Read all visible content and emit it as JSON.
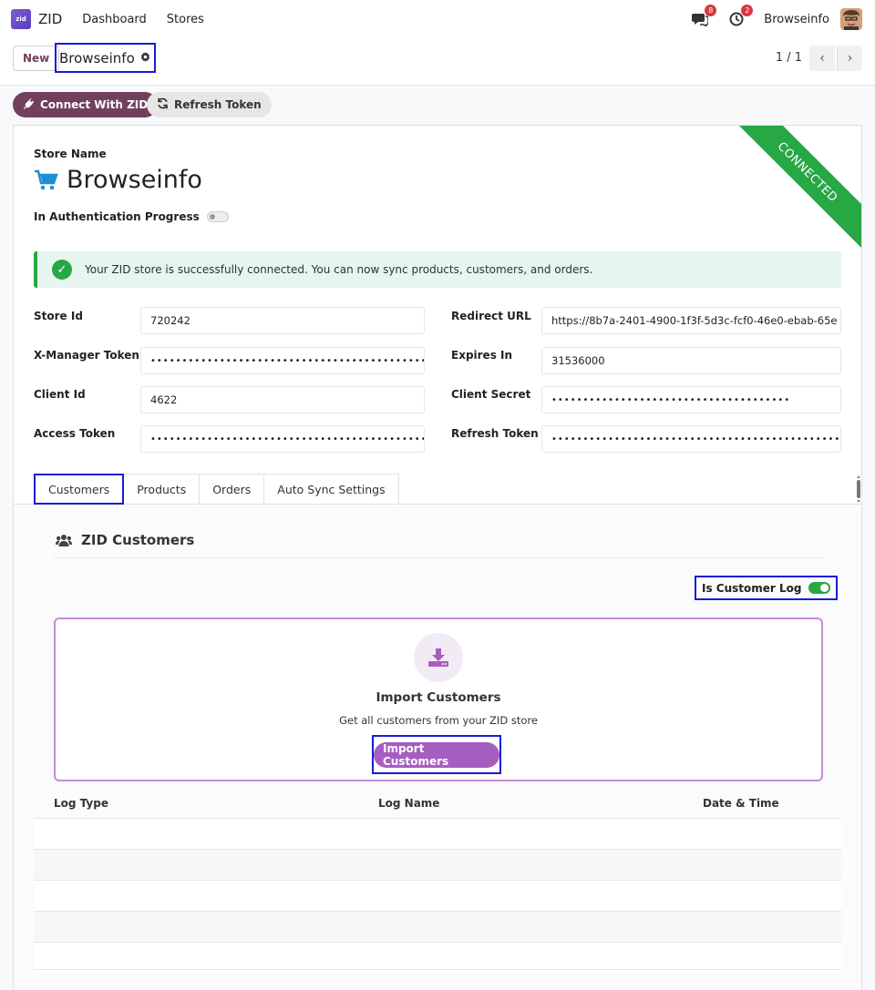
{
  "navbar": {
    "logo_text": "zid",
    "app_name": "ZID",
    "menu": [
      "Dashboard",
      "Stores"
    ],
    "messages_count": "8",
    "activities_count": "2",
    "company": "Browseinfo"
  },
  "control": {
    "new_label": "New",
    "breadcrumb": "Browseinfo",
    "pager": "1 / 1"
  },
  "actions": {
    "connect_label": "Connect With ZID",
    "refresh_label": "Refresh Token"
  },
  "form": {
    "ribbon": "CONNECTED",
    "store_name_label": "Store Name",
    "store_name": "Browseinfo",
    "auth_label": "In Authentication Progress",
    "alert": "Your ZID store is successfully connected. You can now sync products, customers, and orders.",
    "fields": {
      "store_id": {
        "label": "Store Id",
        "value": "720242"
      },
      "xmanager": {
        "label": "X-Manager Token",
        "value": "••••••••••••••••••••••••••••••••••••••••••••••••••••••••••"
      },
      "client_id": {
        "label": "Client Id",
        "value": "4622"
      },
      "access_token": {
        "label": "Access Token",
        "value": "••••••••••••••••••••••••••••••••••••••••••••••••••••••••••"
      },
      "redirect_url": {
        "label": "Redirect URL",
        "value": "https://8b7a-2401-4900-1f3f-5d3c-fcf0-46e0-ebab-65e"
      },
      "expires_in": {
        "label": "Expires In",
        "value": "31536000"
      },
      "client_secret": {
        "label": "Client Secret",
        "value": "••••••••••••••••••••••••••••••••••••••"
      },
      "refresh_token": {
        "label": "Refresh Token",
        "value": "••••••••••••••••••••••••••••••••••••••••••••••••••••••••••••••••••"
      }
    }
  },
  "tabs": [
    "Customers",
    "Products",
    "Orders",
    "Auto Sync Settings"
  ],
  "customers": {
    "section_title": "ZID Customers",
    "log_toggle_label": "Is Customer Log",
    "import_title": "Import Customers",
    "import_sub": "Get all customers from your ZID store",
    "import_button": "Import Customers",
    "columns": [
      "Log Type",
      "Log Name",
      "Date & Time"
    ]
  },
  "colors": {
    "brand": "#71405d",
    "success": "#28a745",
    "import_purple": "#a55ec0",
    "highlight_box": "#1a1ad4"
  }
}
